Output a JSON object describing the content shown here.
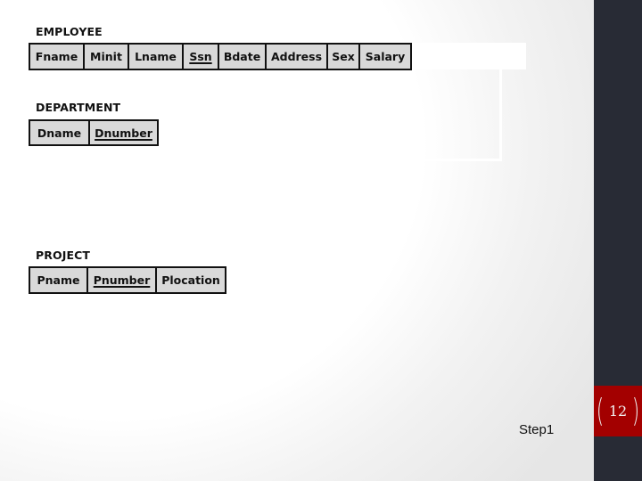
{
  "slide": {
    "page_number": "12",
    "step_label": "Step1",
    "colors": {
      "sidebar": "#282b35",
      "page_badge": "#a30000",
      "cell_fill": "#d9d9d9",
      "border": "#111111"
    }
  },
  "relations": [
    {
      "name": "EMPLOYEE",
      "attributes": [
        {
          "label": "Fname",
          "key": false
        },
        {
          "label": "Minit",
          "key": false
        },
        {
          "label": "Lname",
          "key": false
        },
        {
          "label": "Ssn",
          "key": true
        },
        {
          "label": "Bdate",
          "key": false
        },
        {
          "label": "Address",
          "key": false
        },
        {
          "label": "Sex",
          "key": false
        },
        {
          "label": "Salary",
          "key": false
        }
      ]
    },
    {
      "name": "DEPARTMENT",
      "attributes": [
        {
          "label": "Dname",
          "key": false
        },
        {
          "label": "Dnumber",
          "key": true
        }
      ]
    },
    {
      "name": "PROJECT",
      "attributes": [
        {
          "label": "Pname",
          "key": false
        },
        {
          "label": "Pnumber",
          "key": true
        },
        {
          "label": "Plocation",
          "key": false
        }
      ]
    }
  ]
}
